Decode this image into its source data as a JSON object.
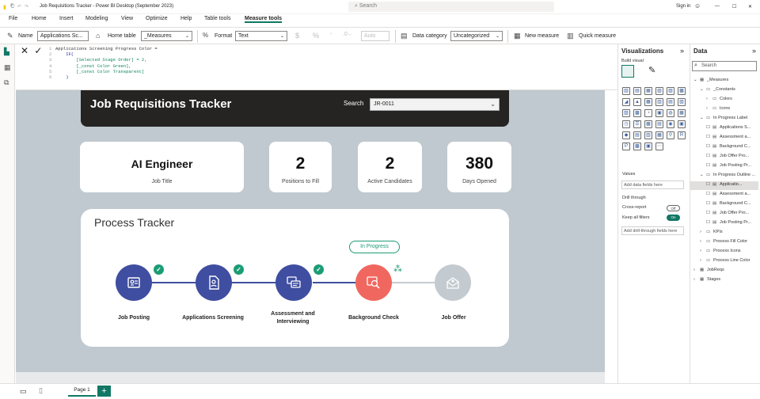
{
  "window": {
    "title": "Job Requisitions Tracker - Power BI Desktop (September 2023)",
    "search_placeholder": "Search",
    "signin": "Sign in"
  },
  "menu": [
    "File",
    "Home",
    "Insert",
    "Modeling",
    "View",
    "Optimize",
    "Help",
    "Table tools",
    "Measure tools"
  ],
  "ribbon": {
    "name_label": "Name",
    "name_value": "Applications Sc...",
    "home_table_label": "Home table",
    "home_table_value": "_Measures",
    "format_label": "Format",
    "format_value": "Text",
    "currency": "$",
    "percent": "%",
    "comma": "’",
    "auto_placeholder": "Auto",
    "data_category_label": "Data category",
    "data_category_value": "Uncategorized",
    "new_measure": "New measure",
    "quick_measure": "Quick measure"
  },
  "formula": {
    "lines": [
      {
        "n": "1",
        "text": "Applications Screening Progress Color ="
      },
      {
        "n": "2",
        "text": "    IF("
      },
      {
        "n": "3",
        "text": "        [Selected Stage Order] = 2,"
      },
      {
        "n": "4",
        "text": "        [_const Color Green],"
      },
      {
        "n": "5",
        "text": "        [_const Color Transparent]"
      },
      {
        "n": "6",
        "text": "    )"
      }
    ]
  },
  "report": {
    "title": "Job Requisitions Tracker",
    "search_label": "Search",
    "search_value": "JR-0011",
    "cards": [
      {
        "value": "AI Engineer",
        "label": "Job Title"
      },
      {
        "value": "2",
        "label": "Positions to Fill"
      },
      {
        "value": "2",
        "label": "Active Candidates"
      },
      {
        "value": "380",
        "label": "Days Opened"
      }
    ],
    "tracker_title": "Process Tracker",
    "status_badge": "In Progress",
    "steps": [
      {
        "label": "Job Posting",
        "state": "done",
        "color": "#3f4ea0"
      },
      {
        "label": "Applications Screening",
        "state": "done",
        "color": "#3f4ea0"
      },
      {
        "label": "Assessment and Interviewing",
        "state": "done",
        "color": "#3f4ea0"
      },
      {
        "label": "Background Check",
        "state": "in-progress",
        "color": "#f0675f"
      },
      {
        "label": "Job Offer",
        "state": "pending",
        "color": "#c4cbd0"
      }
    ]
  },
  "visualizations": {
    "title": "Visualizations",
    "build_visual": "Build visual",
    "values_label": "Values",
    "values_placeholder": "Add data fields here",
    "drill_label": "Drill through",
    "cross_report": "Cross-report",
    "cross_report_state": "Off",
    "keep_filters": "Keep all filters",
    "keep_filters_state": "On",
    "drill_placeholder": "Add drill-through fields here"
  },
  "data": {
    "title": "Data",
    "search_placeholder": "Search",
    "tree": [
      {
        "level": 0,
        "label": "_Measures",
        "icon": "table",
        "expanded": true
      },
      {
        "level": 1,
        "label": "_Constants",
        "icon": "folder",
        "expanded": true
      },
      {
        "level": 2,
        "label": "Colors",
        "icon": "folder"
      },
      {
        "level": 2,
        "label": "Icons",
        "icon": "folder"
      },
      {
        "level": 1,
        "label": "In Progress Label",
        "icon": "folder",
        "expanded": true
      },
      {
        "level": 2,
        "label": "Applications S...",
        "icon": "measure"
      },
      {
        "level": 2,
        "label": "Assessment a...",
        "icon": "measure"
      },
      {
        "level": 2,
        "label": "Background C...",
        "icon": "measure"
      },
      {
        "level": 2,
        "label": "Job Offer Pro...",
        "icon": "measure"
      },
      {
        "level": 2,
        "label": "Job Posting Pr...",
        "icon": "measure"
      },
      {
        "level": 1,
        "label": "In Progress Outline ...",
        "icon": "folder",
        "expanded": true
      },
      {
        "level": 2,
        "label": "Applicatio...",
        "icon": "measure",
        "selected": true
      },
      {
        "level": 2,
        "label": "Assessment a...",
        "icon": "measure"
      },
      {
        "level": 2,
        "label": "Background C...",
        "icon": "measure"
      },
      {
        "level": 2,
        "label": "Job Offer Pro...",
        "icon": "measure"
      },
      {
        "level": 2,
        "label": "Job Posting Pr...",
        "icon": "measure"
      },
      {
        "level": 1,
        "label": "KPIs",
        "icon": "folder"
      },
      {
        "level": 1,
        "label": "Process Fill Color",
        "icon": "folder"
      },
      {
        "level": 1,
        "label": "Process Icons",
        "icon": "folder"
      },
      {
        "level": 1,
        "label": "Process Line Color",
        "icon": "folder"
      },
      {
        "level": 0,
        "label": "JobReqs",
        "icon": "table"
      },
      {
        "level": 0,
        "label": "Stages",
        "icon": "table"
      }
    ]
  },
  "status": {
    "page_tab": "Page 1",
    "add_page": "+"
  }
}
